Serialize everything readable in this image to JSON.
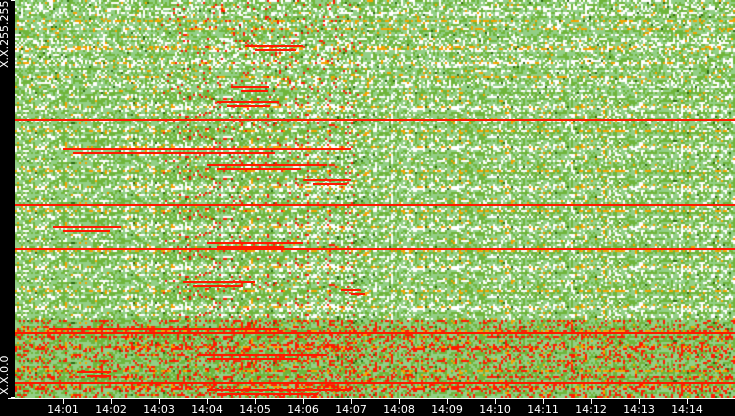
{
  "chart_data": {
    "type": "heatmap",
    "title": "",
    "xlabel": "",
    "ylabel": "",
    "x_range_minutes_after_14_00": [
      0,
      15
    ],
    "x_ticks": [
      "14:01",
      "14:02",
      "14:03",
      "14:04",
      "14:05",
      "14:06",
      "14:07",
      "14:08",
      "14:09",
      "14:10",
      "14:11",
      "14:12",
      "14:13",
      "14:14"
    ],
    "y_ticks": {
      "top": "X.X.255.255",
      "bottom": "X.X.0.0"
    },
    "y_range": [
      0,
      255
    ],
    "colors": {
      "empty": "#ffffff",
      "low": "#93cf86",
      "mid": "#6fb53a",
      "dark": "#2e6b12",
      "high": "#f5a300",
      "max": "#ff1a00"
    },
    "full_width_hot_rows": [
      179,
      124,
      96,
      42,
      10
    ],
    "hot_region_minutes": [
      3,
      7.2
    ],
    "hot_bands": [
      {
        "row": 226,
        "from": 4.8,
        "to": 6.0
      },
      {
        "row": 200,
        "from": 4.5,
        "to": 5.3
      },
      {
        "row": 190,
        "from": 4.2,
        "to": 5.5
      },
      {
        "row": 160,
        "from": 1.0,
        "to": 7.0
      },
      {
        "row": 150,
        "from": 4.0,
        "to": 6.5
      },
      {
        "row": 140,
        "from": 6.0,
        "to": 7.0
      },
      {
        "row": 110,
        "from": 0.8,
        "to": 2.2
      },
      {
        "row": 100,
        "from": 4.0,
        "to": 6.0
      },
      {
        "row": 75,
        "from": 3.5,
        "to": 5.0
      },
      {
        "row": 70,
        "from": 6.8,
        "to": 7.2
      },
      {
        "row": 45,
        "from": 0.7,
        "to": 5.5
      },
      {
        "row": 28,
        "from": 3.8,
        "to": 6.5
      },
      {
        "row": 17,
        "from": 1.3,
        "to": 2.0
      },
      {
        "row": 6,
        "from": 4.0,
        "to": 7.0
      }
    ]
  }
}
